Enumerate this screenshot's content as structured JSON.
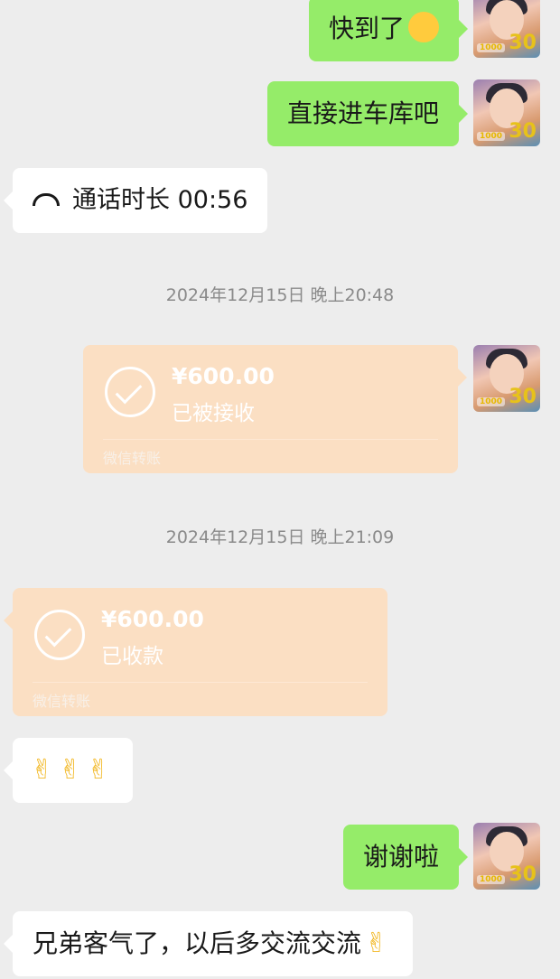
{
  "messages": [
    {
      "text": "快到了",
      "emoji": "thinking-face-emoji"
    },
    {
      "text": "直接进车库吧"
    },
    {
      "call_text": "通话时长 00:56"
    },
    {
      "text": "谢谢啦"
    },
    {
      "text": "兄弟客气了，以后多交流交流",
      "emoji": "pinched-fingers-emoji"
    }
  ],
  "timestamps": [
    "2024年12月15日 晚上20:48",
    "2024年12月15日 晚上21:09"
  ],
  "transfers": [
    {
      "amount": "¥600.00",
      "status": "已被接收",
      "label": "微信转账"
    },
    {
      "amount": "¥600.00",
      "status": "已收款",
      "label": "微信转账"
    }
  ],
  "avatar": {
    "badge": "1000",
    "badge2": "30"
  },
  "colors": {
    "background": "#ededed",
    "green_bubble": "#95ec69",
    "white_bubble": "#ffffff",
    "transfer": "#fbdfc3"
  }
}
